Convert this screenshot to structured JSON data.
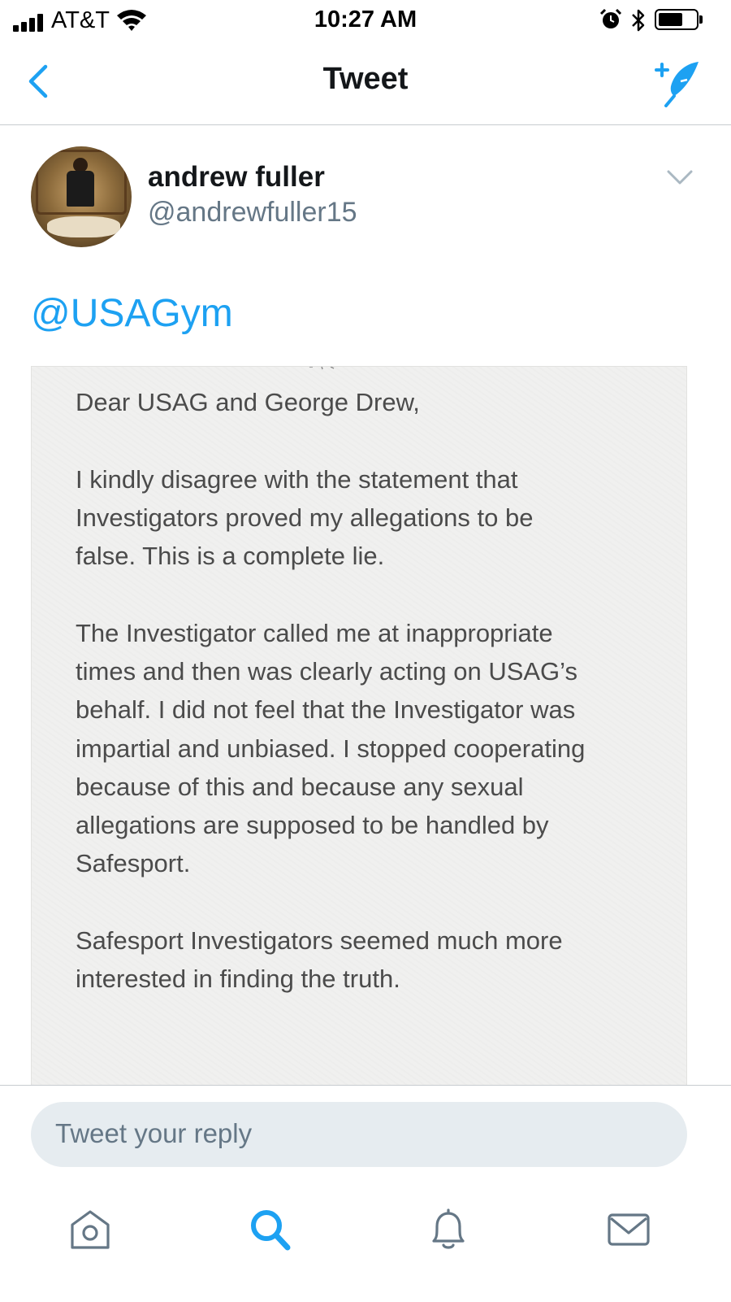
{
  "status_bar": {
    "carrier": "AT&T",
    "time": "10:27 AM",
    "battery_level": 0.65,
    "icons": [
      "signal-icon",
      "wifi-icon",
      "alarm-icon",
      "bluetooth-icon",
      "battery-icon"
    ]
  },
  "nav": {
    "title": "Tweet",
    "back_icon": "chevron-left-icon",
    "compose_icon": "compose-tweet-icon"
  },
  "tweet": {
    "display_name": "andrew fuller",
    "handle": "@andrewfuller15",
    "text": "@USAGym",
    "menu_icon": "chevron-down-icon",
    "image": {
      "paragraphs": [
        "Dear USAG and George Drew,",
        "I kindly disagree with the statement that\nInvestigators proved my allegations to be\nfalse. This is a complete lie.",
        "The Investigator called me at inappropriate\ntimes and then was clearly acting on USAG’s\nbehalf. I did not feel that the Investigator was\nimpartial and unbiased. I stopped cooperating\nbecause of this and because any sexual\nallegations are supposed to be handled by\nSafesport.",
        "Safesport Investigators seemed much more\ninterested in finding the truth."
      ]
    }
  },
  "reply": {
    "placeholder": "Tweet your reply"
  },
  "tabbar": {
    "items": [
      {
        "icon": "home-icon",
        "active": false
      },
      {
        "icon": "search-icon",
        "active": true
      },
      {
        "icon": "notifications-bell-icon",
        "active": false
      },
      {
        "icon": "messages-envelope-icon",
        "active": false
      }
    ]
  },
  "colors": {
    "accent": "#1da1f2",
    "text_primary": "#14171a",
    "text_secondary": "#657786",
    "icon_inactive": "#657786",
    "reply_box": "#e6ecf0"
  }
}
